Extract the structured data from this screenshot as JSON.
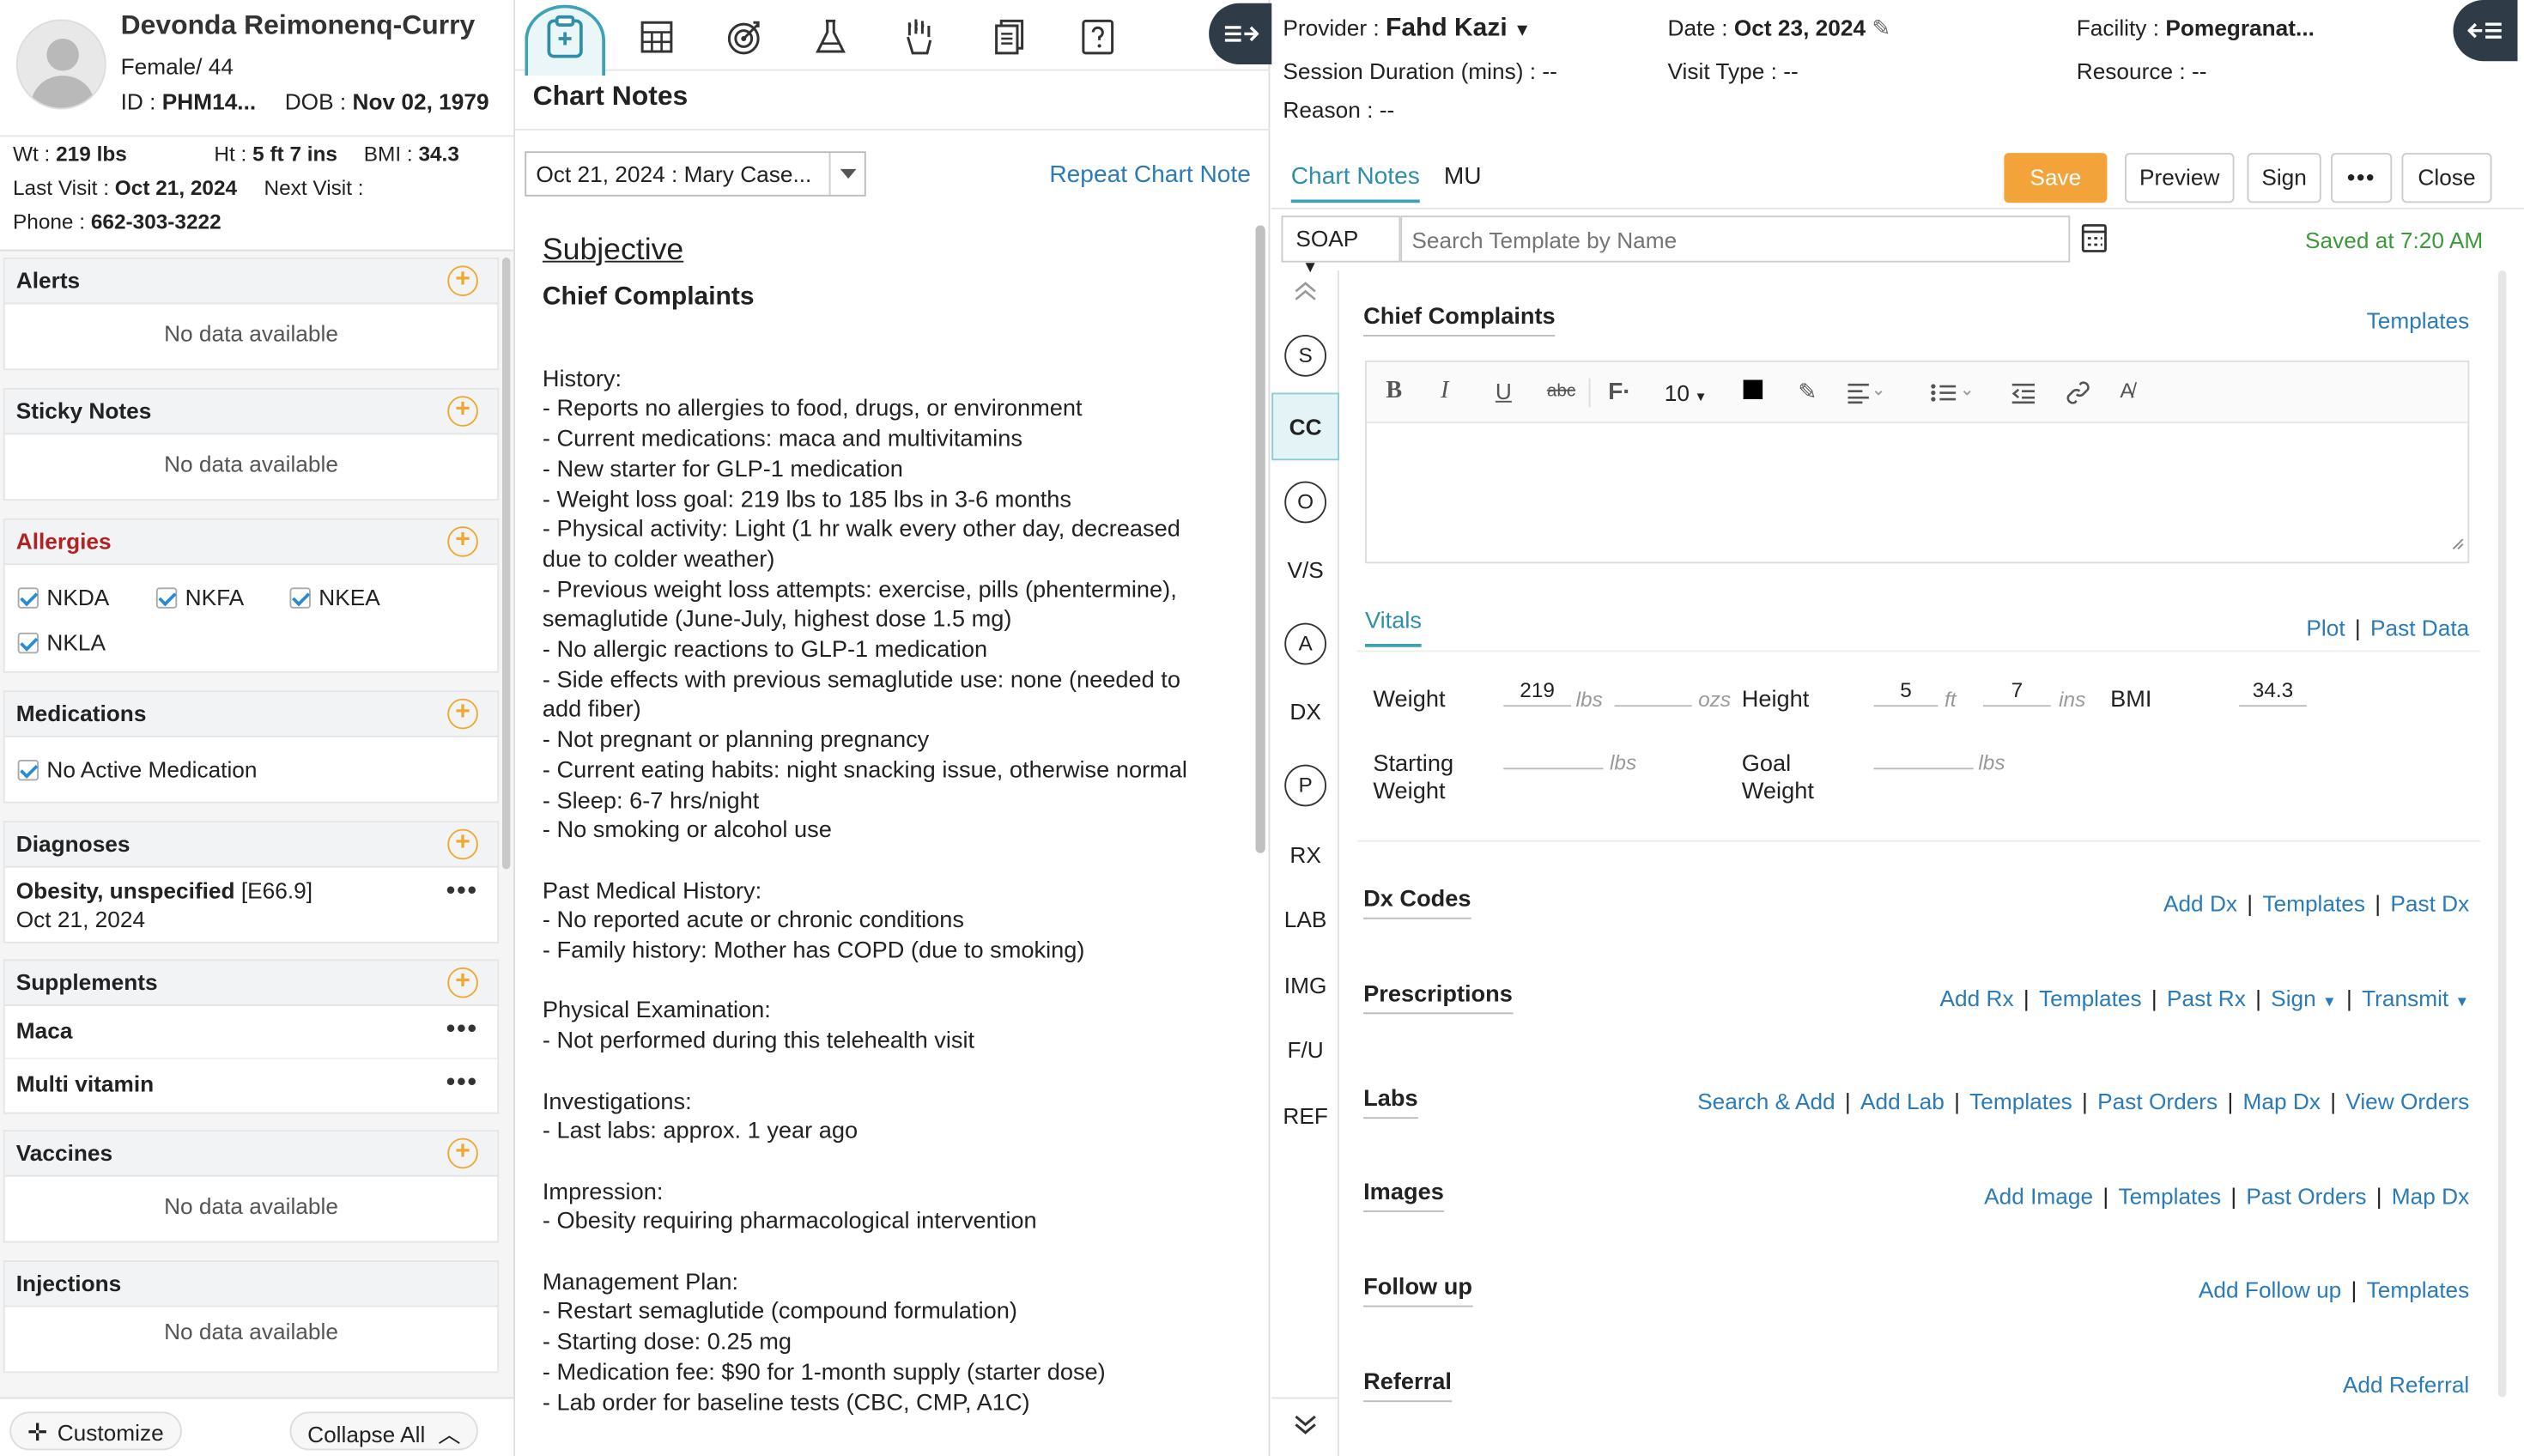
{
  "patient": {
    "name": "Devonda Reimonenq-Curry",
    "gender_age": "Female/ 44",
    "id_label": "ID :",
    "id_value": "PHM14...",
    "dob_label": "DOB :",
    "dob_value": "Nov 02, 1979",
    "wt_label": "Wt :",
    "wt_value": "219 lbs",
    "ht_label": "Ht :",
    "ht_value": "5 ft 7 ins",
    "bmi_label": "BMI :",
    "bmi_value": "34.3",
    "last_visit_label": "Last Visit :",
    "last_visit_value": "Oct 21, 2024",
    "next_visit_label": "Next Visit :",
    "phone_label": "Phone :",
    "phone_value": "662-303-3222"
  },
  "sidebar": {
    "alerts": {
      "title": "Alerts",
      "empty": "No data available"
    },
    "sticky": {
      "title": "Sticky Notes",
      "empty": "No data available"
    },
    "allergies": {
      "title": "Allergies",
      "items": [
        "NKDA",
        "NKFA",
        "NKEA",
        "NKLA"
      ]
    },
    "medications": {
      "title": "Medications",
      "item": "No Active Medication"
    },
    "diagnoses": {
      "title": "Diagnoses",
      "name": "Obesity, unspecified",
      "code": "[E66.9]",
      "date": "Oct 21, 2024"
    },
    "supplements": {
      "title": "Supplements",
      "items": [
        "Maca",
        "Multi vitamin"
      ]
    },
    "vaccines": {
      "title": "Vaccines",
      "empty": "No data available"
    },
    "injections": {
      "title": "Injections",
      "empty": "No data available"
    },
    "customize": "Customize",
    "collapse_all": "Collapse All"
  },
  "middle": {
    "title": "Chart Notes",
    "note_select": "Oct 21, 2024 : Mary Case...",
    "repeat": "Repeat Chart Note",
    "subjective": "Subjective",
    "chief": "Chief Complaints",
    "lines": [
      "History:",
      "- Reports no allergies to food, drugs, or environment",
      "- Current medications: maca and multivitamins",
      "- New starter for GLP-1 medication",
      "- Weight loss goal: 219 lbs to 185 lbs in 3-6 months",
      "- Physical activity: Light (1 hr walk every other day, decreased",
      "due to colder weather)",
      "- Previous weight loss attempts: exercise, pills (phentermine),",
      "semaglutide (June-July, highest dose 1.5 mg)",
      "- No allergic reactions to GLP-1 medication",
      "- Side effects with previous semaglutide use: none (needed to",
      "add fiber)",
      "- Not pregnant or planning pregnancy",
      "- Current eating habits: night snacking issue, otherwise normal",
      "- Sleep: 6-7 hrs/night",
      "- No smoking or alcohol use",
      "",
      "Past Medical History:",
      "- No reported acute or chronic conditions",
      "- Family history: Mother has COPD (due to smoking)",
      "",
      "Physical Examination:",
      "- Not performed during this telehealth visit",
      "",
      "Investigations:",
      "- Last labs: approx. 1 year ago",
      "",
      "Impression:",
      "- Obesity requiring pharmacological intervention",
      "",
      "Management Plan:",
      "- Restart semaglutide (compound formulation)",
      "- Starting dose: 0.25 mg",
      "- Medication fee: $90 for 1-month supply (starter dose)",
      "- Lab order for baseline tests (CBC, CMP, A1C)"
    ]
  },
  "encounter": {
    "provider_label": "Provider :",
    "provider": "Fahd Kazi",
    "date_label": "Date :",
    "date": "Oct 23, 2024",
    "facility_label": "Facility :",
    "facility": "Pomegranat...",
    "session_label": "Session Duration (mins) :",
    "session": "--",
    "visit_type_label": "Visit Type :",
    "visit_type": "--",
    "resource_label": "Resource :",
    "resource": "--",
    "reason_label": "Reason :",
    "reason": "--"
  },
  "tabs": {
    "chart_notes": "Chart Notes",
    "mu": "MU"
  },
  "actions": {
    "save": "Save",
    "preview": "Preview",
    "sign": "Sign",
    "more": "•••",
    "close": "Close"
  },
  "template": {
    "type": "SOAP",
    "placeholder": "Search Template by Name",
    "saved": "Saved at 7:20 AM"
  },
  "nav": [
    "S",
    "CC",
    "O",
    "V/S",
    "A",
    "DX",
    "P",
    "RX",
    "LAB",
    "IMG",
    "F/U",
    "REF"
  ],
  "chief": {
    "title": "Chief Complaints",
    "templates": "Templates",
    "font_size": "10"
  },
  "vitals": {
    "title": "Vitals",
    "plot": "Plot",
    "past": "Past Data",
    "weight_label": "Weight",
    "weight": "219",
    "lbs": "lbs",
    "ozs": "ozs",
    "height_label": "Height",
    "height_ft": "5",
    "ft": "ft",
    "height_in": "7",
    "ins": "ins",
    "bmi_label": "BMI",
    "bmi": "34.3",
    "start_label1": "Starting",
    "start_label2": "Weight",
    "goal_label1": "Goal",
    "goal_label2": "Weight"
  },
  "sections": {
    "dx": {
      "title": "Dx Codes",
      "links": [
        "Add Dx",
        "Templates",
        "Past Dx"
      ]
    },
    "rx": {
      "title": "Prescriptions",
      "links": [
        "Add Rx",
        "Templates",
        "Past Rx",
        "Sign",
        "Transmit"
      ]
    },
    "labs": {
      "title": "Labs",
      "links": [
        "Search & Add",
        "Add Lab",
        "Templates",
        "Past Orders",
        "Map Dx",
        "View Orders"
      ]
    },
    "images": {
      "title": "Images",
      "links": [
        "Add Image",
        "Templates",
        "Past Orders",
        "Map Dx"
      ]
    },
    "followup": {
      "title": "Follow up",
      "links": [
        "Add Follow up",
        "Templates"
      ]
    },
    "referral": {
      "title": "Referral",
      "links": [
        "Add Referral"
      ]
    }
  },
  "colors": {
    "accent": "#3da2b6",
    "save": "#f2a43a",
    "link": "#2b7bb9",
    "allergy": "#b22222",
    "plus": "#f0a830"
  }
}
